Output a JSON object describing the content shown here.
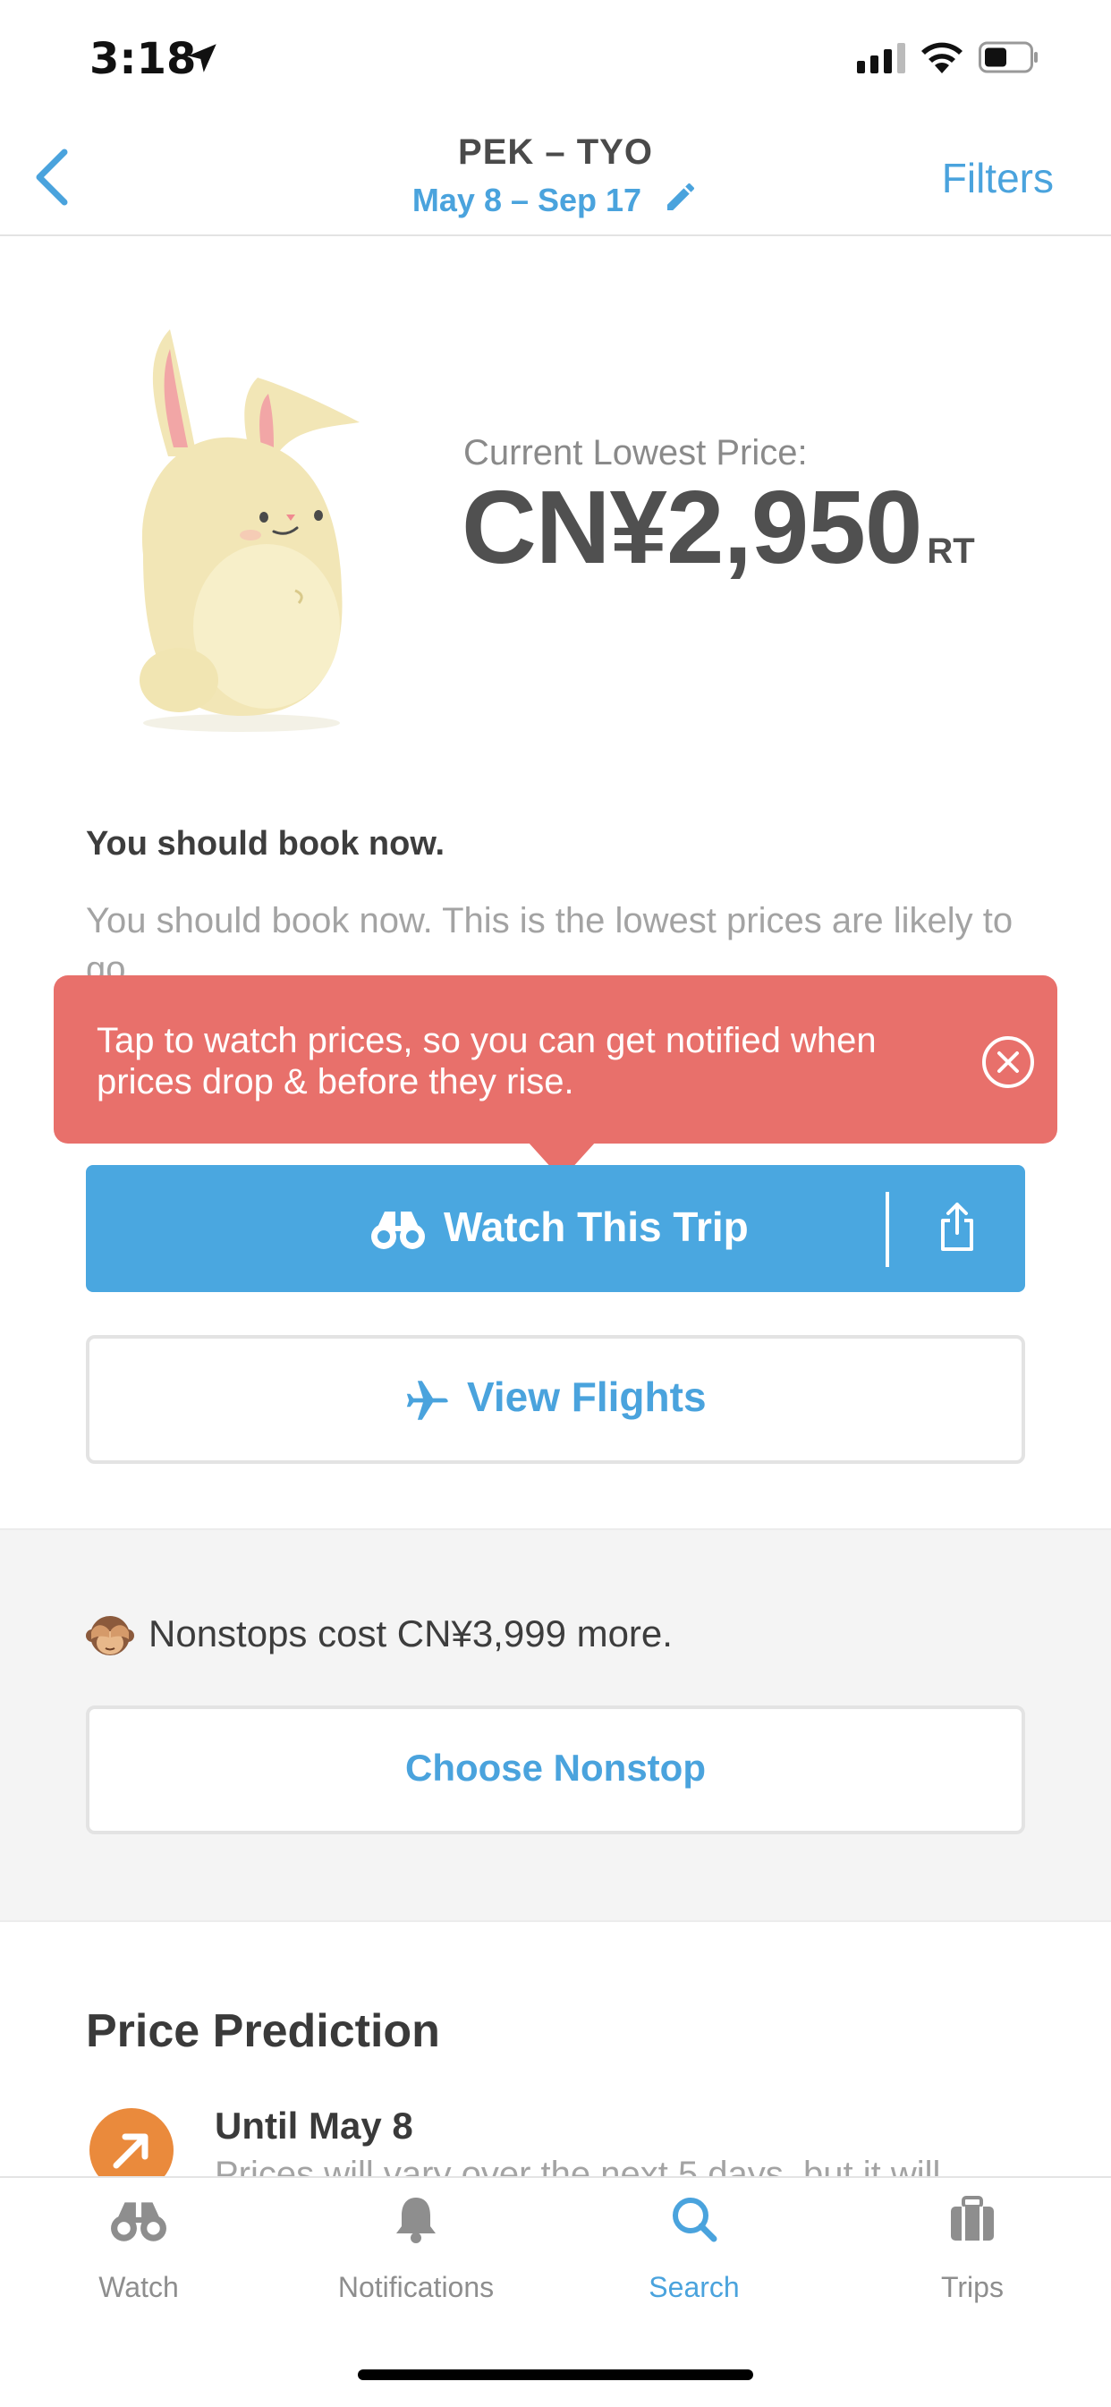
{
  "status_bar": {
    "time": "3:18"
  },
  "nav": {
    "route": "PEK – TYO",
    "dates": "May 8 – Sep 17",
    "filters_label": "Filters"
  },
  "hero": {
    "price_label": "Current Lowest Price:",
    "price_value": "CN¥2,950",
    "price_suffix": "RT"
  },
  "recommendation": {
    "title": "You should book now.",
    "text": "You should book now. This is the lowest prices are likely to go."
  },
  "tooltip": {
    "text": "Tap to watch prices, so you can get notified when prices drop & before they rise."
  },
  "actions": {
    "watch_label": "Watch This Trip",
    "view_flights_label": "View Flights"
  },
  "nonstop": {
    "text": "Nonstops cost CN¥3,999 more.",
    "button_label": "Choose Nonstop"
  },
  "prediction": {
    "title": "Price Prediction",
    "until": "Until May 8",
    "description": "Prices will vary over the next 5 days, but it will"
  },
  "tabs": [
    {
      "label": "Watch",
      "icon": "binoculars-icon",
      "active": false
    },
    {
      "label": "Notifications",
      "icon": "bell-icon",
      "active": false
    },
    {
      "label": "Search",
      "icon": "search-icon",
      "active": true
    },
    {
      "label": "Trips",
      "icon": "suitcase-icon",
      "active": false
    }
  ],
  "colors": {
    "accent": "#4aa3dd",
    "watch_button": "#4aa7e0",
    "tooltip": "#e8706b",
    "prediction_icon": "#ea8a3c"
  }
}
